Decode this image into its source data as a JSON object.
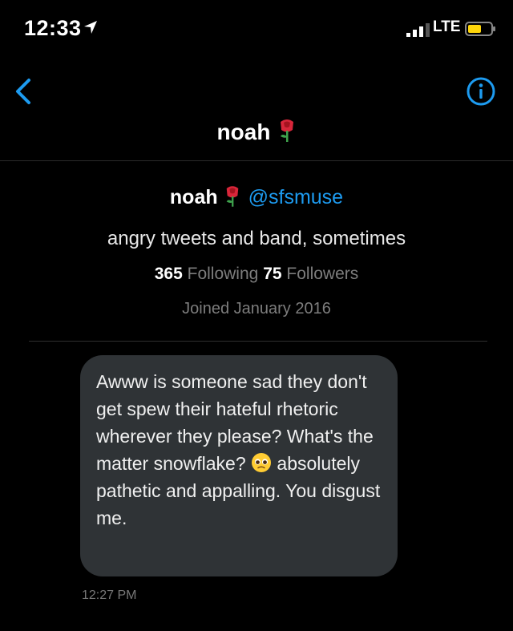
{
  "status_bar": {
    "time": "12:33",
    "network": "LTE",
    "location_icon": "location-arrow-icon",
    "signal_icon": "signal-bars-icon",
    "battery_icon": "battery-icon",
    "battery_color": "#ffd60a"
  },
  "nav": {
    "back_icon": "chevron-left-icon",
    "info_icon": "info-circle-icon",
    "title": "noah",
    "title_emoji": "rose-icon",
    "accent": "#1d9bf0"
  },
  "profile": {
    "name": "noah",
    "handle": "@sfsmuse",
    "bio": "angry tweets and band, sometimes",
    "following_count": "365",
    "following_label": "Following",
    "followers_count": "75",
    "followers_label": "Followers",
    "joined": "Joined January 2016"
  },
  "message": {
    "text_before_emoji": "Awww is someone sad they don't get spew their hateful rhetoric wherever they please? What's the matter snowflake?",
    "emoji": "pleading-face-icon",
    "text_after_emoji": "absolutely pathetic and appalling. You disgust me.",
    "timestamp": "12:27 PM"
  }
}
